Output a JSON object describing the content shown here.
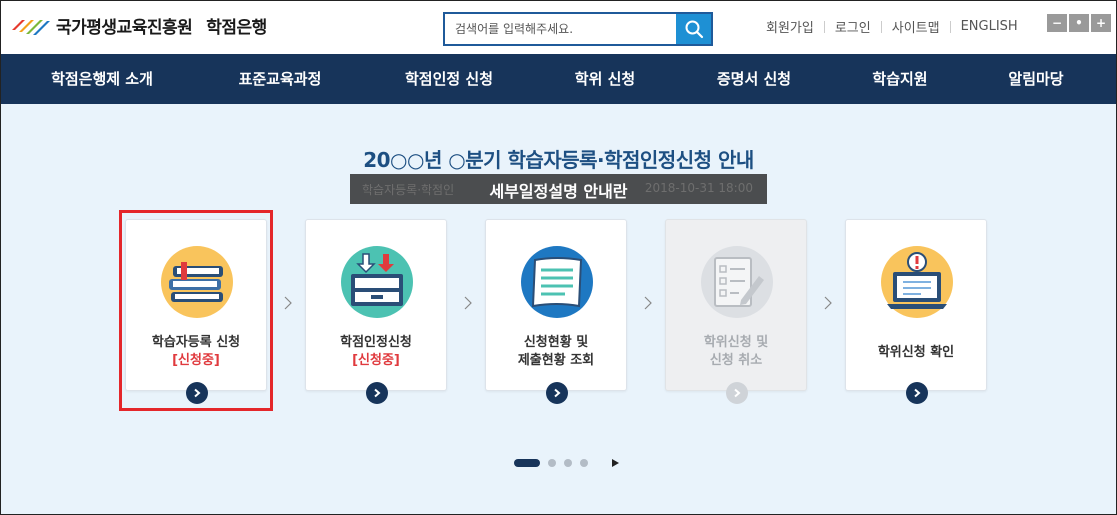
{
  "header": {
    "org_name": "국가평생교육진흥원",
    "service_name": "학점은행",
    "search_placeholder": "검색어를 입력해주세요.",
    "util_links": [
      "회원가입",
      "로그인",
      "사이트맵",
      "ENGLISH"
    ],
    "zoom_buttons": [
      "−",
      "•",
      "+"
    ]
  },
  "nav": {
    "items": [
      "학점은행제 소개",
      "표준교육과정",
      "학점인정 신청",
      "학위 신청",
      "증명서 신청",
      "학습지원",
      "알림마당"
    ]
  },
  "main": {
    "headline": "20○○년 ○분기 학습자등록·학점인정신청 안내",
    "tooltip": {
      "text": "세부일정설명 안내란",
      "under_left": "학습자등록·학점인",
      "under_date": "2018-10-31 18:00"
    },
    "cards": [
      {
        "line1": "학습자등록 신청",
        "line2": "[신청중]",
        "status": true,
        "disabled": false,
        "icon": "books-icon"
      },
      {
        "line1": "학점인정신청",
        "line2": "[신청중]",
        "status": true,
        "disabled": false,
        "icon": "inbox-tray-icon"
      },
      {
        "line1": "신청현황 및",
        "line2": "제출현황 조회",
        "status": false,
        "disabled": false,
        "icon": "document-scroll-icon"
      },
      {
        "line1": "학위신청 및",
        "line2": "신청 취소",
        "status": false,
        "disabled": true,
        "icon": "checklist-pen-icon"
      },
      {
        "line1": "학위신청 확인",
        "line2": "",
        "status": false,
        "disabled": false,
        "icon": "laptop-alert-icon"
      }
    ],
    "pager": {
      "total": 4,
      "current": 1
    }
  },
  "colors": {
    "nav_bg": "#17345a",
    "main_bg": "#e9f3fb",
    "headline": "#1d4f82",
    "status_red": "#e03a3e",
    "highlight": "#e4262a",
    "search_btn": "#1e90d4"
  }
}
